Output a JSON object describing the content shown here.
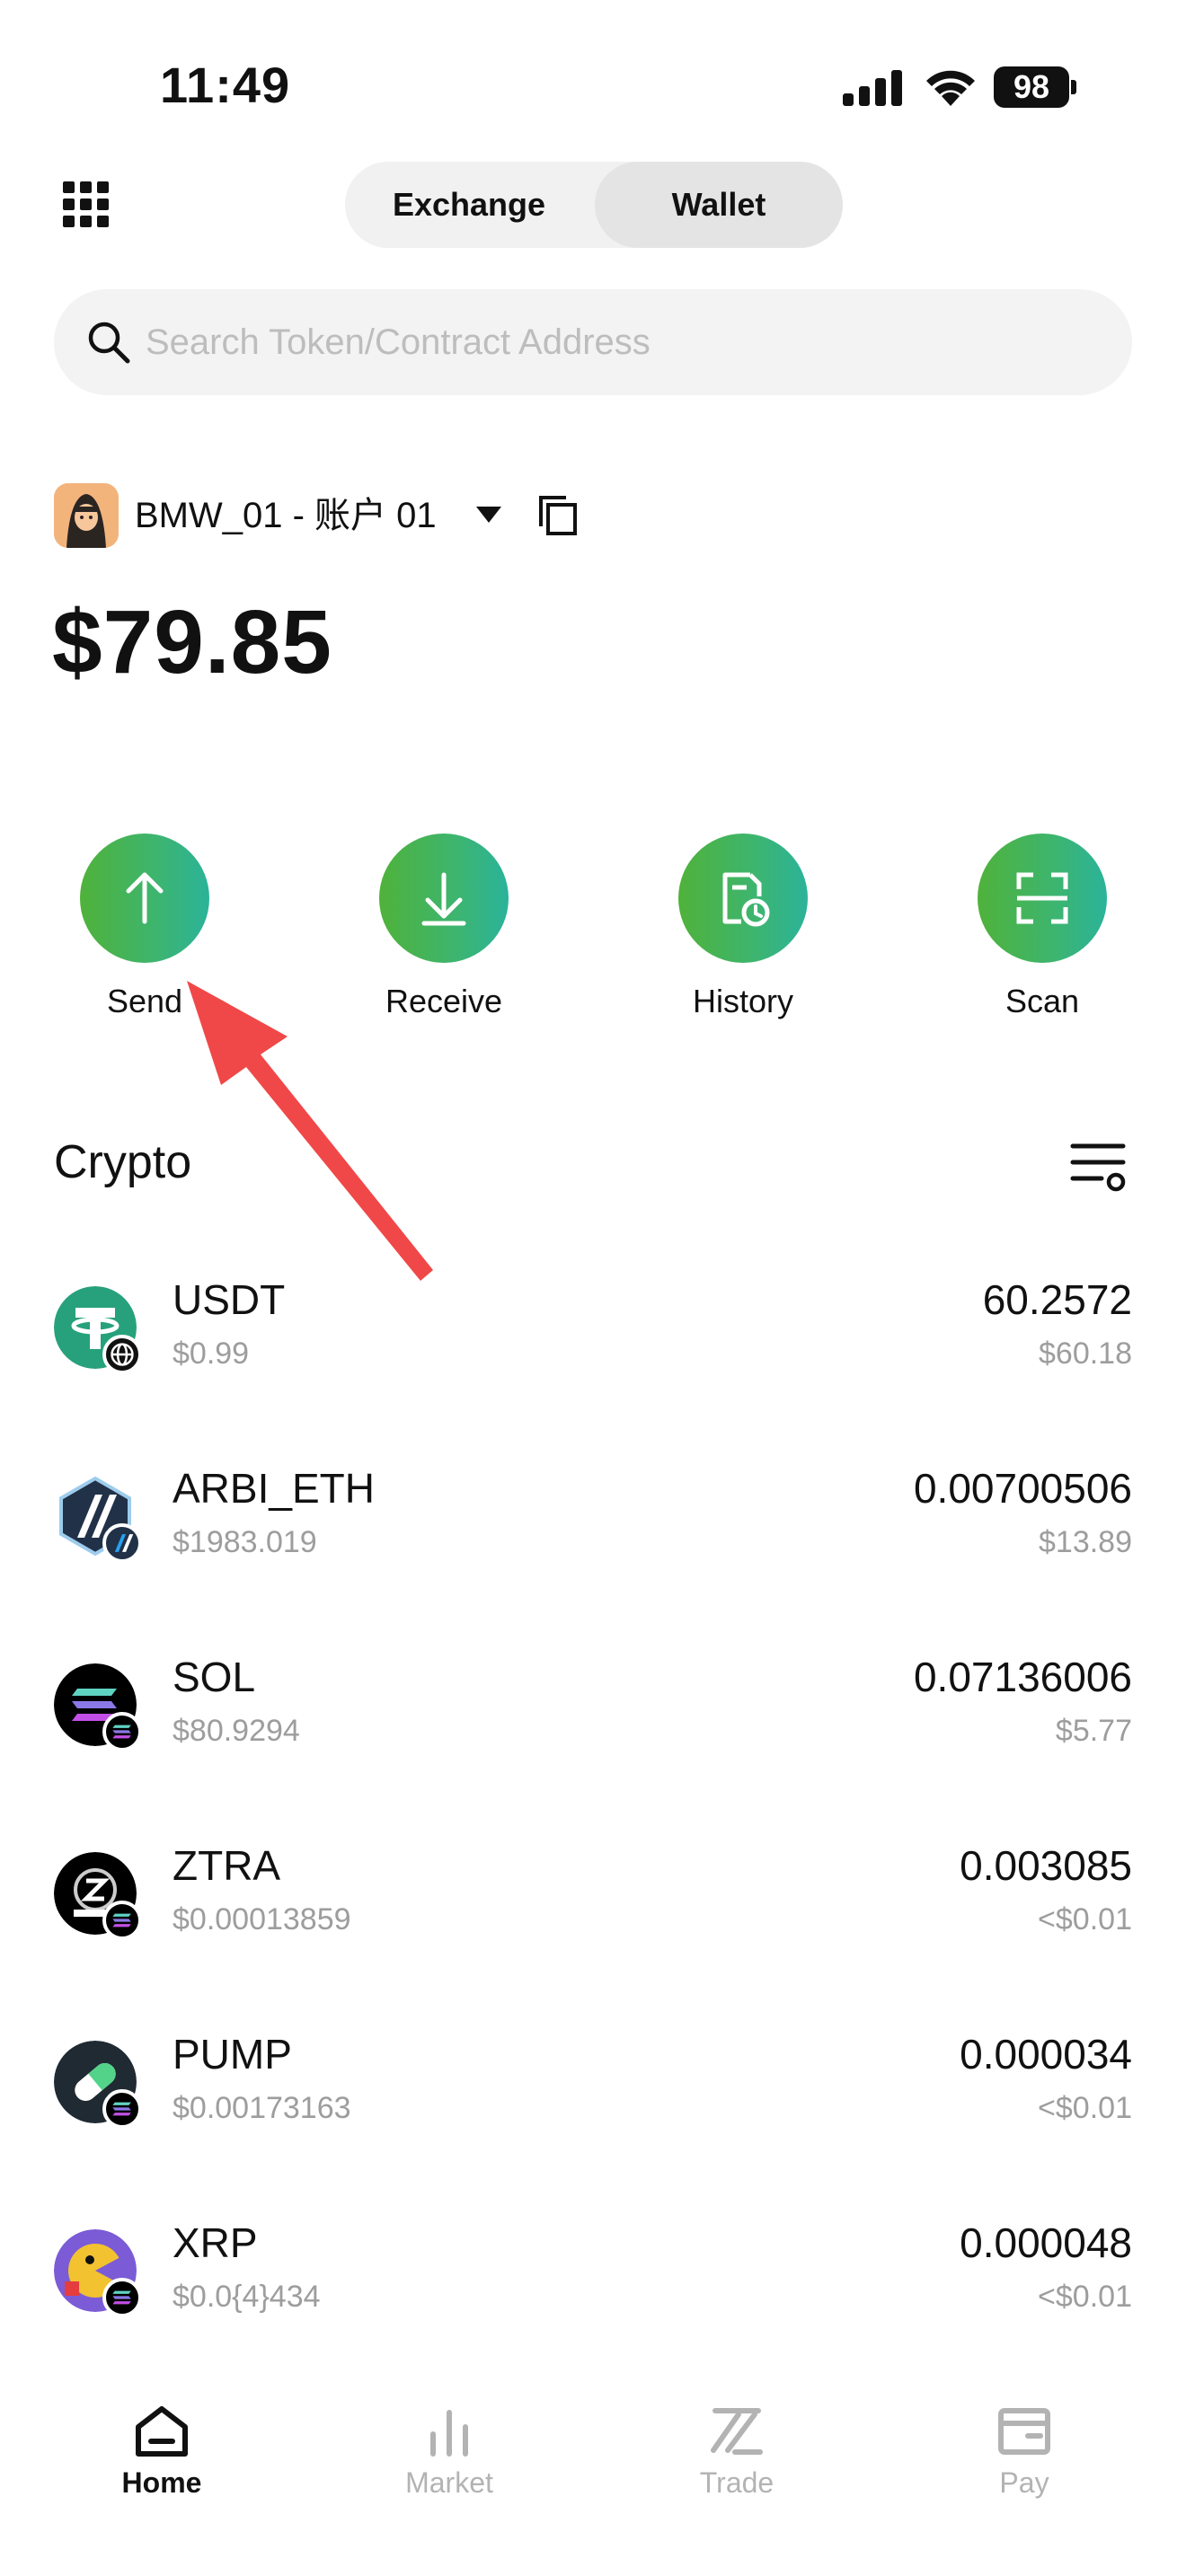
{
  "status_bar": {
    "time": "11:49",
    "battery": "98"
  },
  "header": {
    "tabs": [
      {
        "label": "Exchange",
        "active": false
      },
      {
        "label": "Wallet",
        "active": true
      }
    ]
  },
  "search": {
    "placeholder": "Search Token/Contract Address",
    "value": ""
  },
  "account": {
    "name": "BMW_01 - 账户 01",
    "balance": "$79.85"
  },
  "actions": [
    {
      "label": "Send",
      "icon": "arrow-up-icon"
    },
    {
      "label": "Receive",
      "icon": "arrow-down-icon"
    },
    {
      "label": "History",
      "icon": "history-icon"
    },
    {
      "label": "Scan",
      "icon": "scan-icon"
    }
  ],
  "crypto": {
    "title": "Crypto",
    "tokens": [
      {
        "symbol": "USDT",
        "price": "$0.99",
        "amount": "60.2572",
        "value": "$60.18",
        "color": "#26a17b"
      },
      {
        "symbol": "ARBI_ETH",
        "price": "$1983.019",
        "amount": "0.00700506",
        "value": "$13.89",
        "color": "#213147"
      },
      {
        "symbol": "SOL",
        "price": "$80.9294",
        "amount": "0.07136006",
        "value": "$5.77",
        "color": "#000000"
      },
      {
        "symbol": "ZTRA",
        "price": "$0.00013859",
        "amount": "0.003085",
        "value": "<$0.01",
        "color": "#000000"
      },
      {
        "symbol": "PUMP",
        "price": "$0.00173163",
        "amount": "0.000034",
        "value": "<$0.01",
        "color": "#1f2a33"
      },
      {
        "symbol": "XRP",
        "price": "$0.0{4}434",
        "amount": "0.000048",
        "value": "<$0.01",
        "color": "#7b5bd6"
      }
    ]
  },
  "bottom_nav": [
    {
      "label": "Home",
      "icon": "home-icon",
      "active": true
    },
    {
      "label": "Market",
      "icon": "market-icon",
      "active": false
    },
    {
      "label": "Trade",
      "icon": "trade-icon",
      "active": false
    },
    {
      "label": "Pay",
      "icon": "pay-icon",
      "active": false
    }
  ],
  "colors": {
    "accent_gradient_start": "#4fb23a",
    "accent_gradient_end": "#2bb39a",
    "annotation_arrow": "#f04848"
  }
}
